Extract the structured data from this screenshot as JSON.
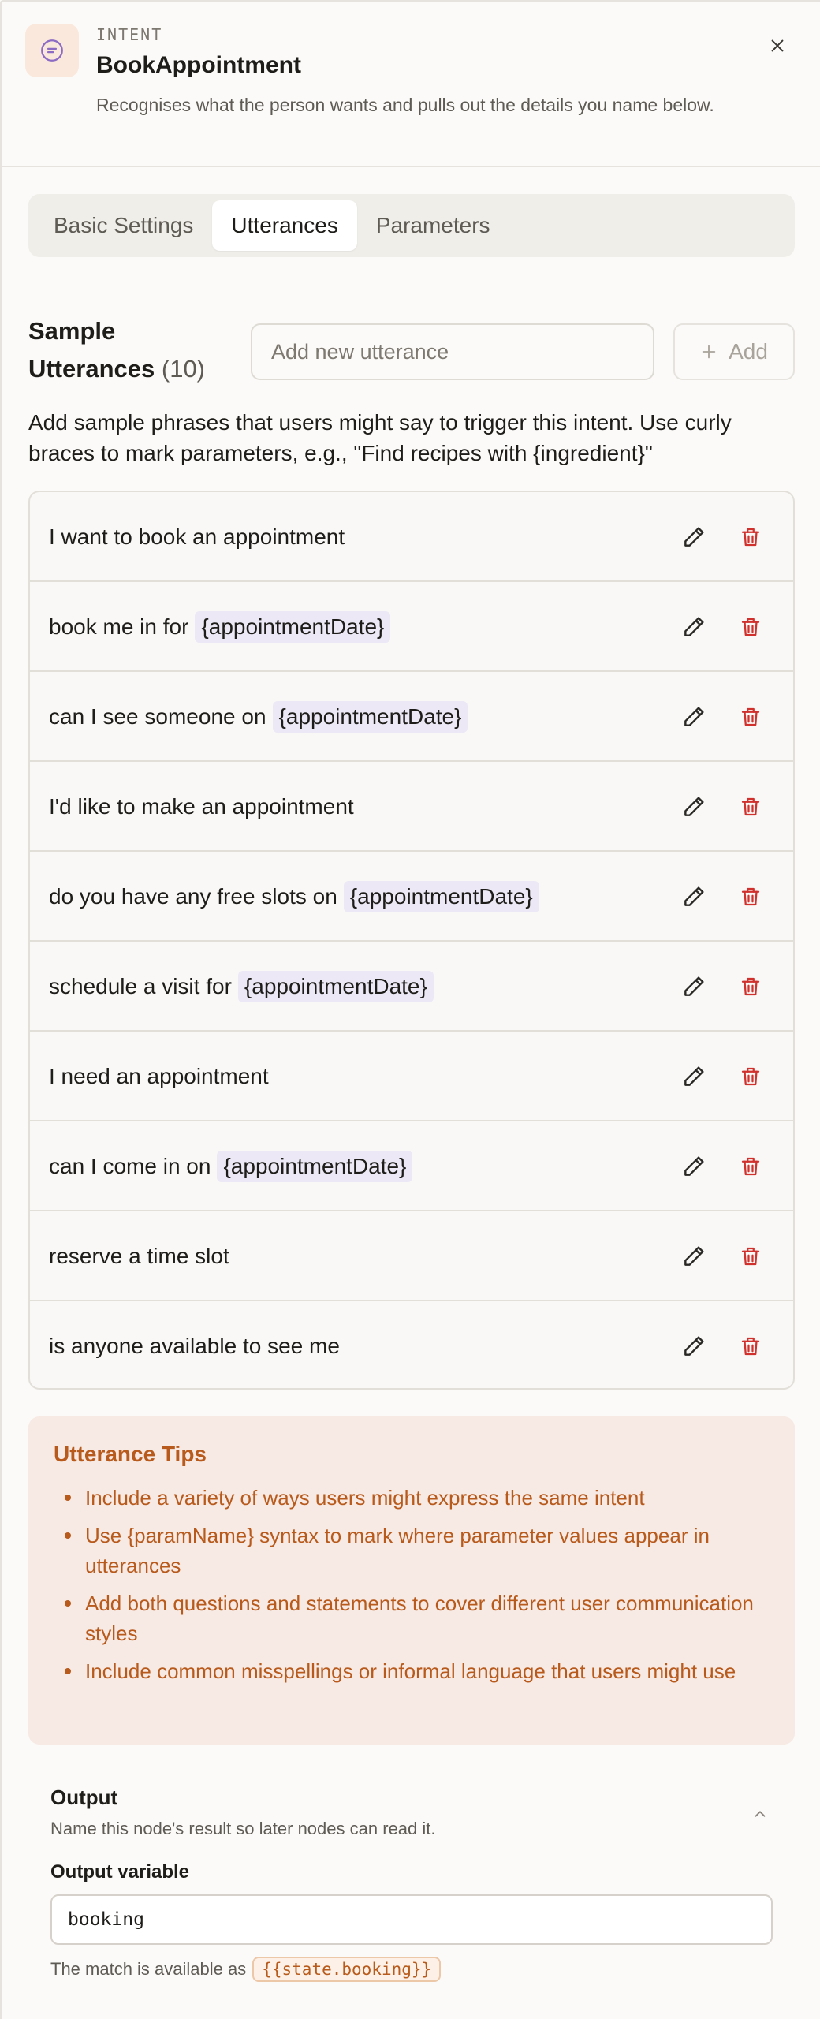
{
  "header": {
    "kind_label": "INTENT",
    "title": "BookAppointment",
    "description": "Recognises what the person wants and pulls out the details you name below."
  },
  "tabs": [
    {
      "label": "Basic Settings",
      "active": false
    },
    {
      "label": "Utterances",
      "active": true
    },
    {
      "label": "Parameters",
      "active": false
    }
  ],
  "utterances_section": {
    "title": "Sample Utterances",
    "count": "(10)",
    "add_placeholder": "Add new utterance",
    "add_label": "Add",
    "help_text": "Add sample phrases that users might say to trigger this intent. Use curly braces to mark parameters, e.g., \"Find recipes with {ingredient}\""
  },
  "utterances": [
    {
      "text": "I want to book an appointment",
      "param": ""
    },
    {
      "text": "book me in for",
      "param": "{appointmentDate}"
    },
    {
      "text": "can I see someone on",
      "param": "{appointmentDate}"
    },
    {
      "text": "I'd like to make an appointment",
      "param": ""
    },
    {
      "text": "do you have any free slots on",
      "param": "{appointmentDate}"
    },
    {
      "text": "schedule a visit for",
      "param": "{appointmentDate}"
    },
    {
      "text": "I need an appointment",
      "param": ""
    },
    {
      "text": "can I come in on",
      "param": "{appointmentDate}"
    },
    {
      "text": "reserve a time slot",
      "param": ""
    },
    {
      "text": "is anyone available to see me",
      "param": ""
    }
  ],
  "tips": {
    "title": "Utterance Tips",
    "items": [
      "Include a variety of ways users might express the same intent",
      "Use {paramName} syntax to mark where parameter values appear in utterances",
      "Add both questions and statements to cover different user communication styles",
      "Include common misspellings or informal language that users might use"
    ]
  },
  "output": {
    "title": "Output",
    "subtitle": "Name this node's result so later nodes can read it.",
    "variable_label": "Output variable",
    "variable_value": "booking",
    "available_prefix": "The match is available as",
    "available_code": "{{state.booking}}"
  },
  "colors": {
    "accent": "#b85a1b",
    "delete": "#d0312d",
    "param_bg": "#ece8f5",
    "tips_bg": "#f7e9e3"
  },
  "icons": {
    "intent": "chat-bubble-icon",
    "close": "close-icon",
    "add": "plus-icon",
    "edit": "pencil-icon",
    "delete": "trash-icon",
    "collapse": "chevron-up-icon"
  }
}
